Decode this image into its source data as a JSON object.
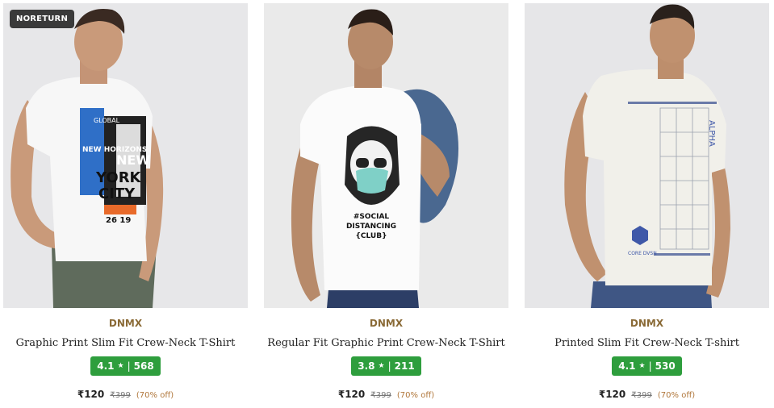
{
  "products": [
    {
      "badge": "NORETURN",
      "brand": "DNMX",
      "name": "Graphic Print Slim Fit Crew-Neck T-Shirt",
      "rating": "4.1",
      "reviews": "568",
      "price": "₹120",
      "mrp": "₹399",
      "discount": "(70% off)",
      "print_text": [
        "GLOBAL",
        "NEW HORIZONS",
        "NEW",
        "YORK",
        "CITY",
        "26 19"
      ]
    },
    {
      "brand": "DNMX",
      "name": "Regular Fit Graphic Print Crew-Neck T-Shirt",
      "rating": "3.8",
      "reviews": "211",
      "price": "₹120",
      "mrp": "₹399",
      "discount": "(70% off)",
      "print_text": [
        "#SOCIAL",
        "DISTANCING",
        "{CLUB}"
      ]
    },
    {
      "brand": "DNMX",
      "name": "Printed Slim Fit Crew-Neck T-shirt",
      "rating": "4.1",
      "reviews": "530",
      "price": "₹120",
      "mrp": "₹399",
      "discount": "(70% off)",
      "print_text": [
        "ALPHA",
        "CORE DVSN"
      ]
    }
  ],
  "colors": {
    "rating_bg": "#2e9e3d",
    "brand": "#8a6a36",
    "discount": "#b0763a",
    "badge_bg": "#3a3a3a"
  },
  "icons": {
    "rating_star": "star-icon"
  }
}
